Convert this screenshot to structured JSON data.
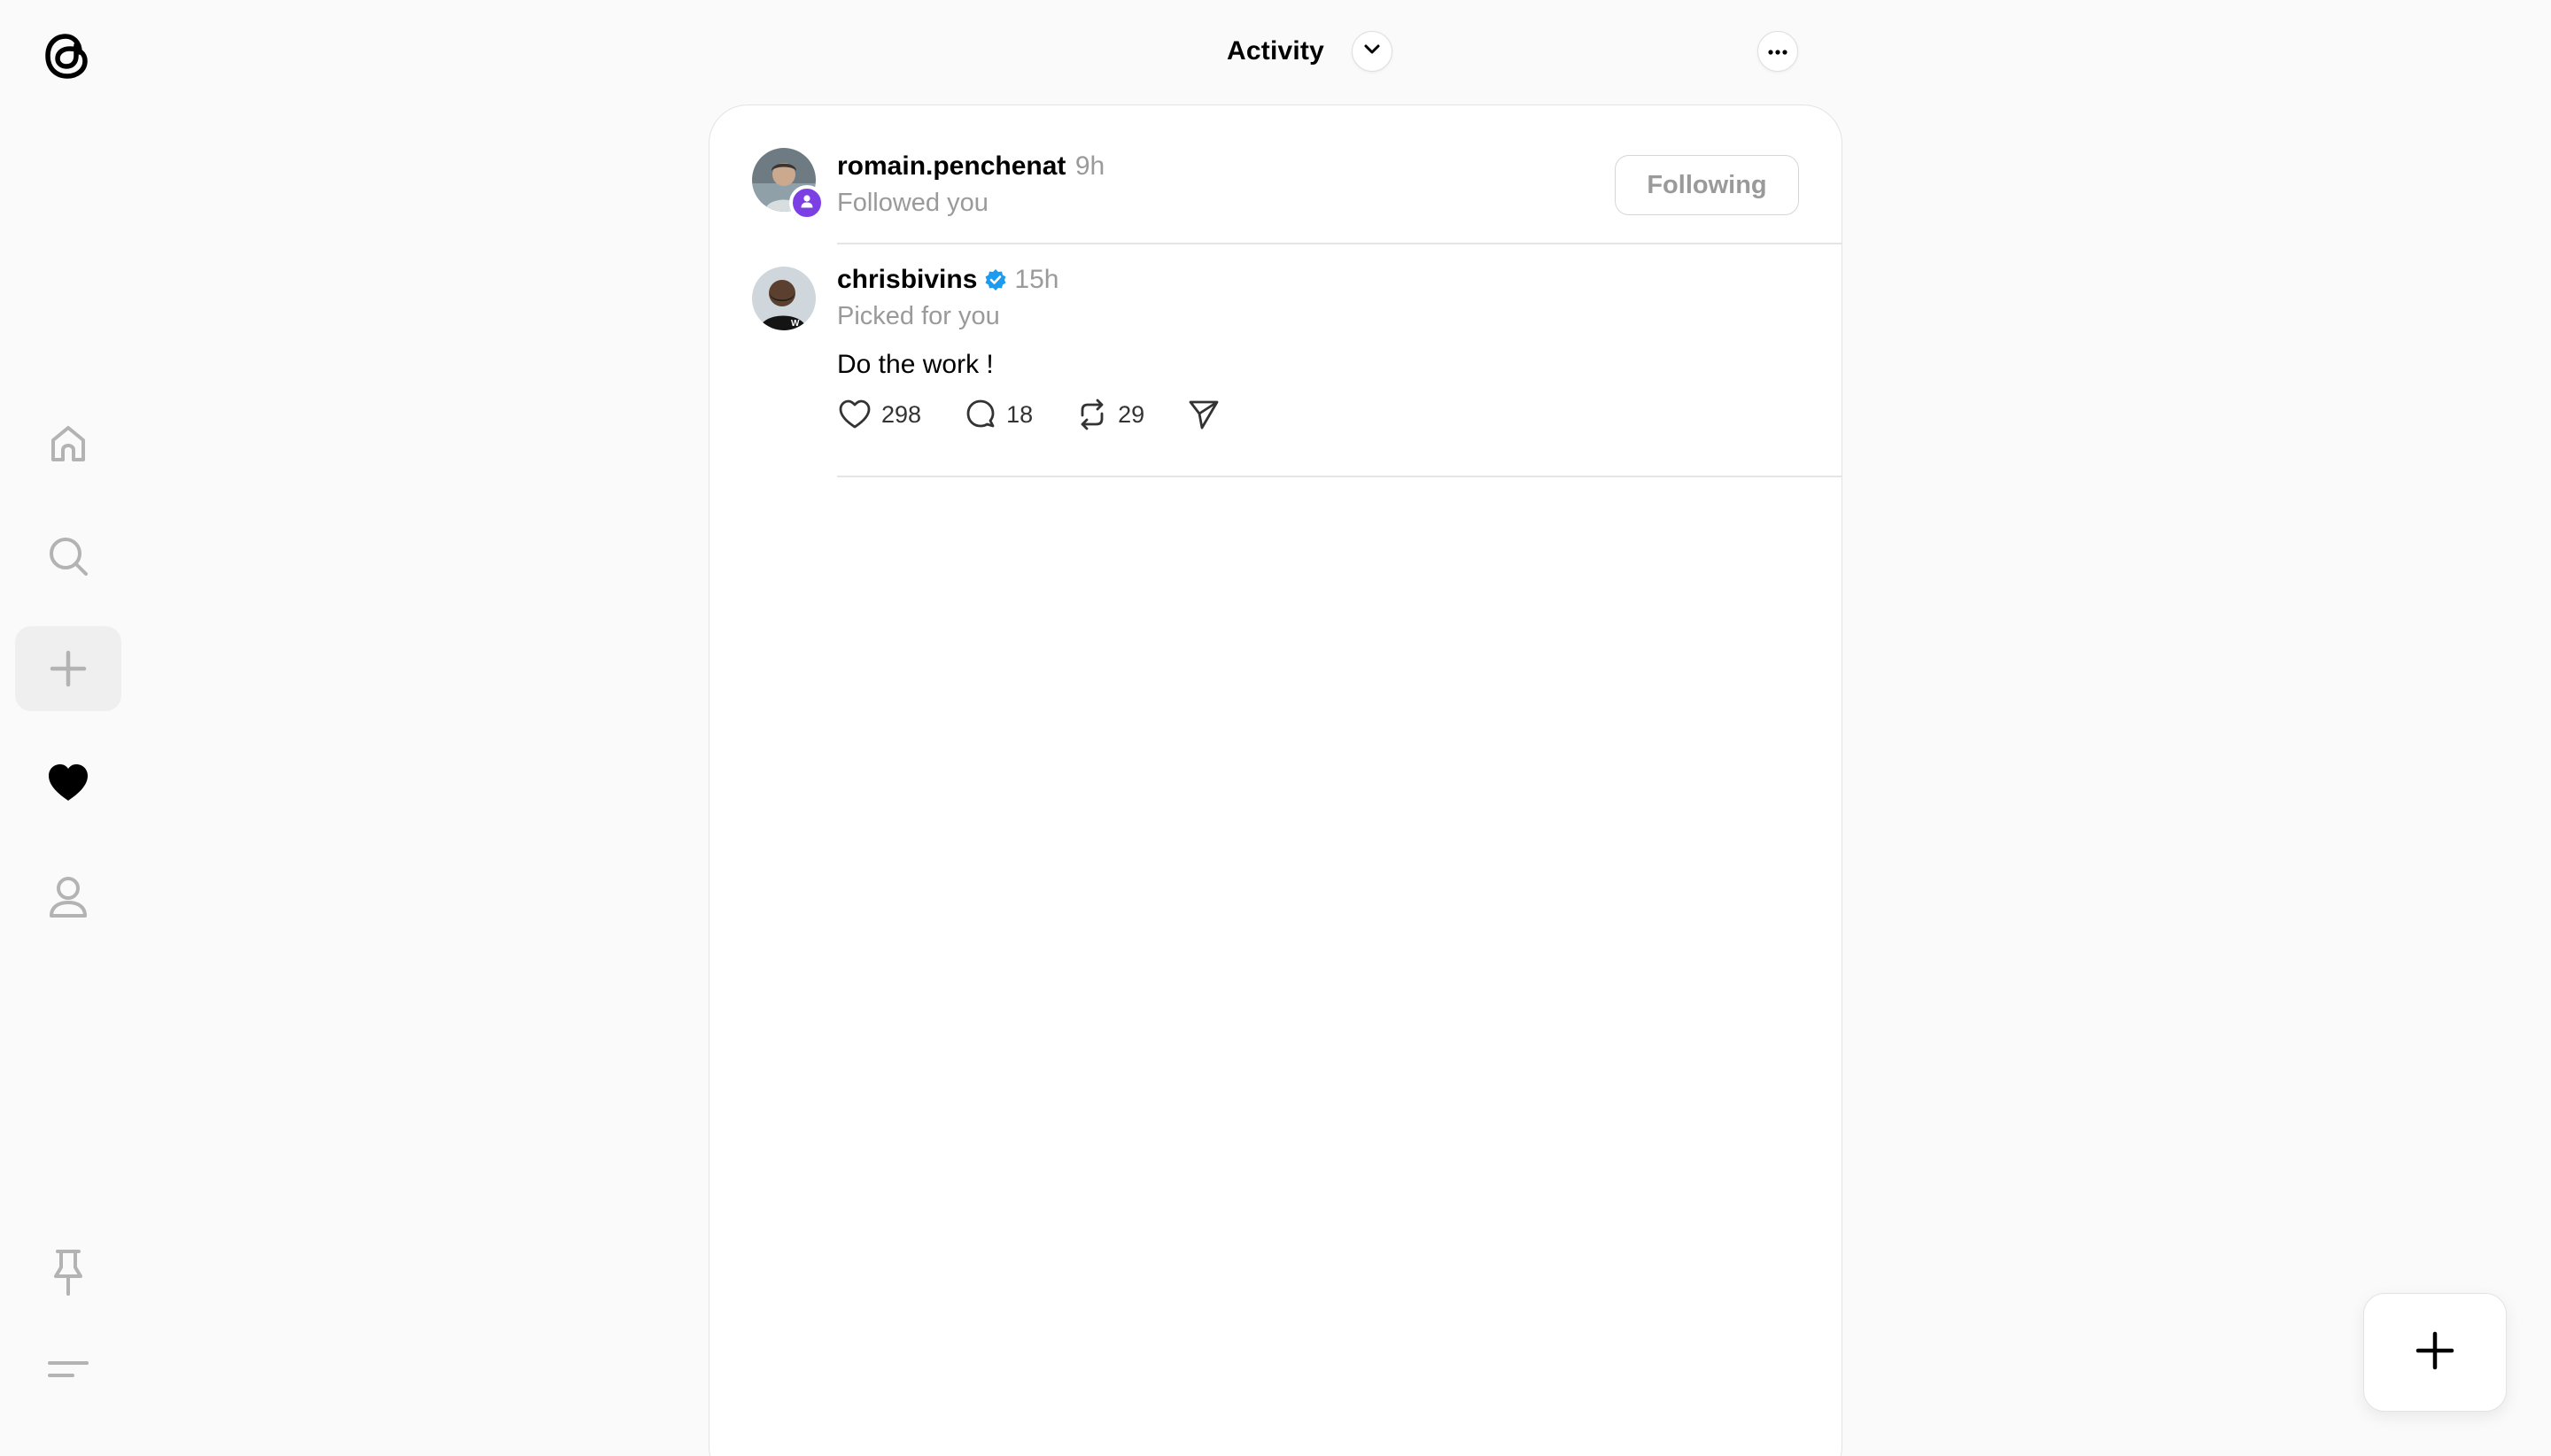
{
  "header": {
    "title": "Activity",
    "dropdown_icon": "chevron-down-icon",
    "more_icon": "ellipsis-icon"
  },
  "sidebar": {
    "logo": "threads-logo",
    "items": [
      {
        "name": "home",
        "icon": "home-icon"
      },
      {
        "name": "search",
        "icon": "search-icon"
      },
      {
        "name": "create",
        "icon": "plus-icon"
      },
      {
        "name": "activity",
        "icon": "heart-icon",
        "active": true
      },
      {
        "name": "profile",
        "icon": "person-icon"
      }
    ],
    "bottom": [
      {
        "name": "pinned",
        "icon": "pin-icon"
      },
      {
        "name": "menu",
        "icon": "menu-icon"
      }
    ]
  },
  "activity": [
    {
      "username": "romain.penchenat",
      "time": "9h",
      "subtitle": "Followed you",
      "button": "Following"
    },
    {
      "username": "chrisbivins",
      "verified": true,
      "time": "15h",
      "subtitle": "Picked for you",
      "text": "Do the work !",
      "likes": "298",
      "replies": "18",
      "reposts": "29"
    }
  ],
  "colors": {
    "badge": "#7b3fe4",
    "verified": "#1d9bf0",
    "muted": "#9a9a9a"
  }
}
